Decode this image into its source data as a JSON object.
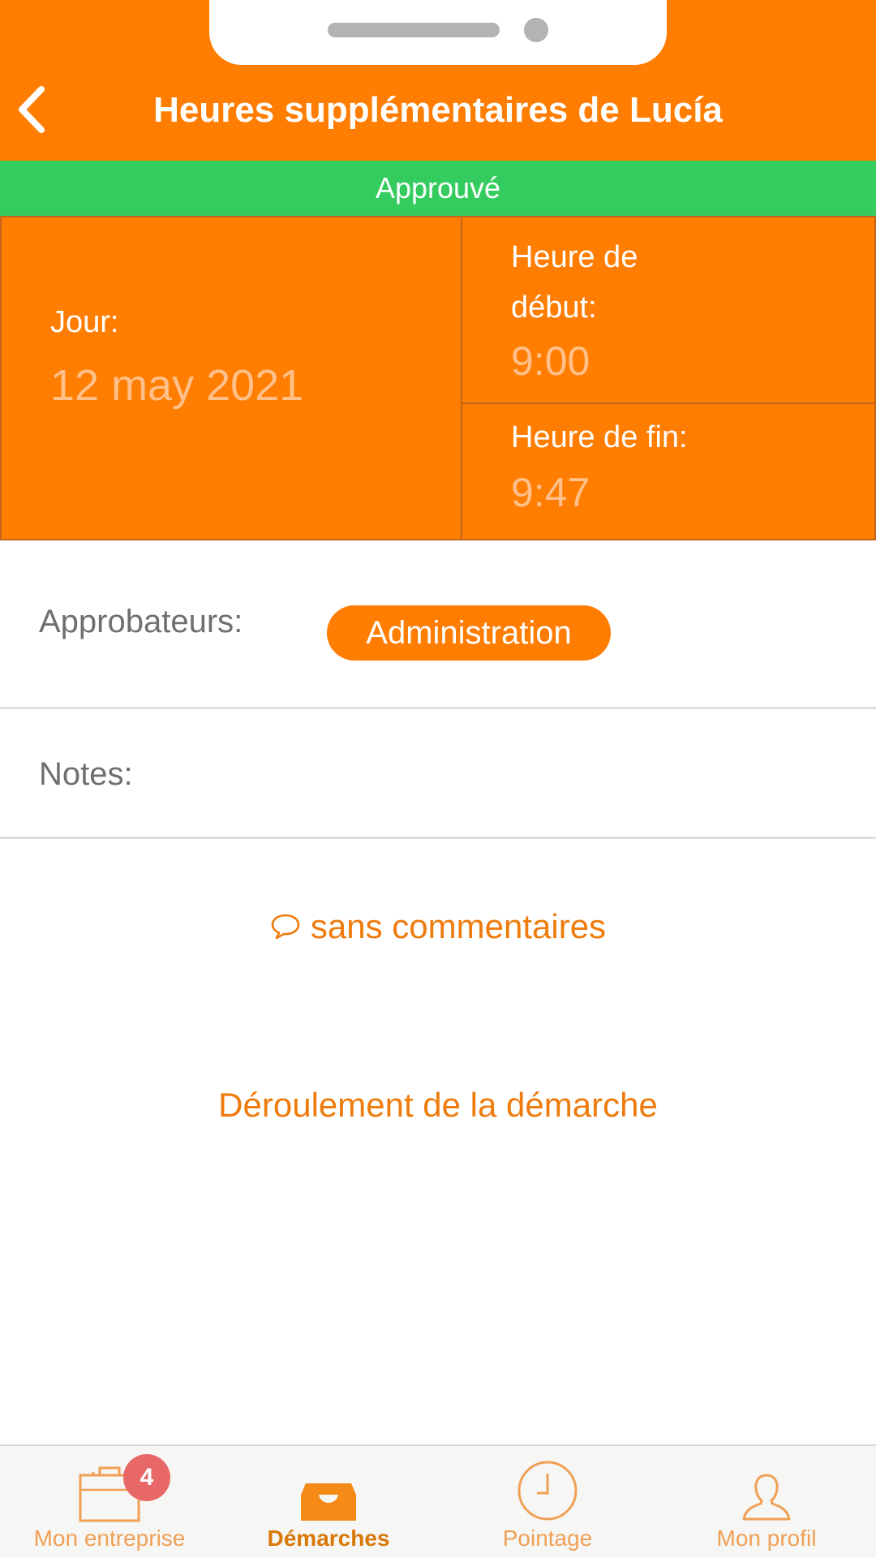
{
  "header": {
    "title": "Heures supplémentaires de Lucía",
    "color": "#ff7d01"
  },
  "status": {
    "label": "Approuvé",
    "color": "#34cc5f"
  },
  "details": {
    "day_label": "Jour:",
    "day_value": "12 may 2021",
    "start_label": "Heure de début:",
    "start_value": "9:00",
    "end_label": "Heure de fin:",
    "end_value": "9:47"
  },
  "approvers": {
    "label": "Approbateurs:",
    "chips": [
      "Administration"
    ]
  },
  "notes": {
    "label": "Notes:"
  },
  "comments": {
    "icon": "speech-bubble-icon",
    "label": "sans commentaires"
  },
  "process_link": {
    "label": "Déroulement de la démarche"
  },
  "bottom_nav": {
    "active": "Démarches",
    "items": [
      {
        "label": "Mon entreprise",
        "icon": "briefcase-icon",
        "badge": "4"
      },
      {
        "label": "Démarches",
        "icon": "inbox-tray-icon"
      },
      {
        "label": "Pointage",
        "icon": "clock-icon"
      },
      {
        "label": "Mon profil",
        "icon": "user-icon"
      }
    ]
  }
}
